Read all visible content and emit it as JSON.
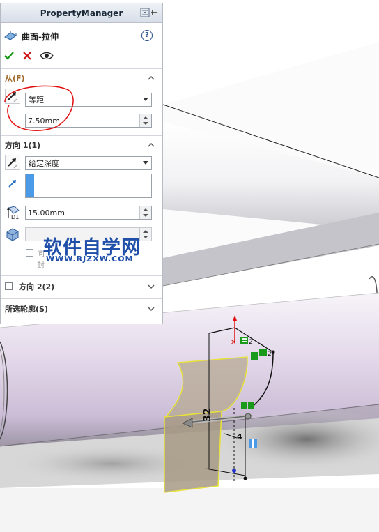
{
  "property_manager": {
    "title": "PropertyManager",
    "feature_name": "曲面-拉伸",
    "help": "?",
    "from": {
      "header": "从(F)",
      "mode": "等距",
      "offset_value": "7.50mm"
    },
    "direction1": {
      "header": "方向 1(1)",
      "end_condition": "给定深度",
      "depth_value": "15.00mm",
      "faint_label_a": "向",
      "faint_label_b": "封"
    },
    "direction2": {
      "header": "方向 2(2)",
      "checked": false
    },
    "selected_contours": {
      "header": "所选轮廓(S)"
    }
  },
  "watermark": {
    "text": "软件自学网",
    "url": "WWW.RJZXW.COM"
  },
  "sketch": {
    "dim_vertical": "32",
    "dim_small": "4",
    "relation_a": "2",
    "relation_b": "2"
  },
  "colors": {
    "accent_blue": "#4a9ae8",
    "ok_green": "#1a9a1a",
    "cancel_red": "#cc1111",
    "annotation_red": "#e01010",
    "watermark_blue": "#1f4fa8",
    "surface_lavender": "#e2d7e9",
    "highlight_yellow": "#e8e23a"
  },
  "icons": [
    "extrude-surface-icon",
    "pushpin-icon",
    "help-icon",
    "ok-check-icon",
    "cancel-x-icon",
    "preview-eye-icon",
    "chevron-up-icon",
    "chevron-down-icon",
    "reverse-direction-icon",
    "direction-arrow-icon",
    "depth-icon",
    "draft-icon"
  ]
}
